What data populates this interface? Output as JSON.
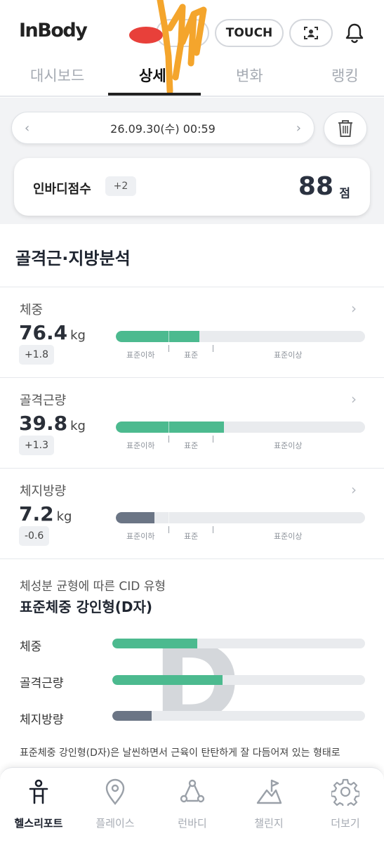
{
  "header": {
    "logo": "InBody",
    "touch_label": "TOUCH",
    "icons": {
      "face": "face-scan-icon",
      "bell": "bell-icon"
    }
  },
  "tabs": [
    {
      "label": "대시보드",
      "active": false
    },
    {
      "label": "상세",
      "active": true
    },
    {
      "label": "변화",
      "active": false
    },
    {
      "label": "랭킹",
      "active": false
    }
  ],
  "date_bar": {
    "date": "26.09.30(수) 00:59",
    "prev": "‹",
    "next": "›"
  },
  "score": {
    "label": "인바디점수",
    "delta": "+2",
    "value": "88",
    "unit": "점"
  },
  "section_title": "골격근·지방분석",
  "scale_labels": {
    "low": "표준이하",
    "mid": "표준",
    "high": "표준이상"
  },
  "metrics": [
    {
      "label": "체중",
      "value": "76.4",
      "unit": "kg",
      "delta": "+1.8",
      "level": 0.335,
      "color": "#4cba8f"
    },
    {
      "label": "골격근량",
      "value": "39.8",
      "unit": "kg",
      "delta": "+1.3",
      "level": 0.435,
      "color": "#4cba8f"
    },
    {
      "label": "체지방량",
      "value": "7.2",
      "unit": "kg",
      "delta": "-0.6",
      "level": 0.155,
      "color": "#6b7585"
    }
  ],
  "cid": {
    "subtitle": "체성분 균형에 따른 CID 유형",
    "title": "표준체중 강인형(D자)",
    "letter": "D",
    "rows": [
      {
        "label": "체중",
        "level": 0.335,
        "color": "#4cba8f"
      },
      {
        "label": "골격근량",
        "level": 0.435,
        "color": "#4cba8f"
      },
      {
        "label": "체지방량",
        "level": 0.155,
        "color": "#6b7585"
      }
    ],
    "description": "표준체중 강인형(D자)은 날씬하면서 근육이 탄탄하게 잘 다듬어져 있는 형태로"
  },
  "bottom_nav": [
    {
      "label": "헬스리포트",
      "icon": "health-report-icon",
      "active": true
    },
    {
      "label": "플레이스",
      "icon": "location-pin-icon",
      "active": false
    },
    {
      "label": "런바디",
      "icon": "runbody-icon",
      "active": false
    },
    {
      "label": "챌린지",
      "icon": "challenge-flag-icon",
      "active": false
    },
    {
      "label": "더보기",
      "icon": "gear-icon",
      "active": false
    }
  ]
}
